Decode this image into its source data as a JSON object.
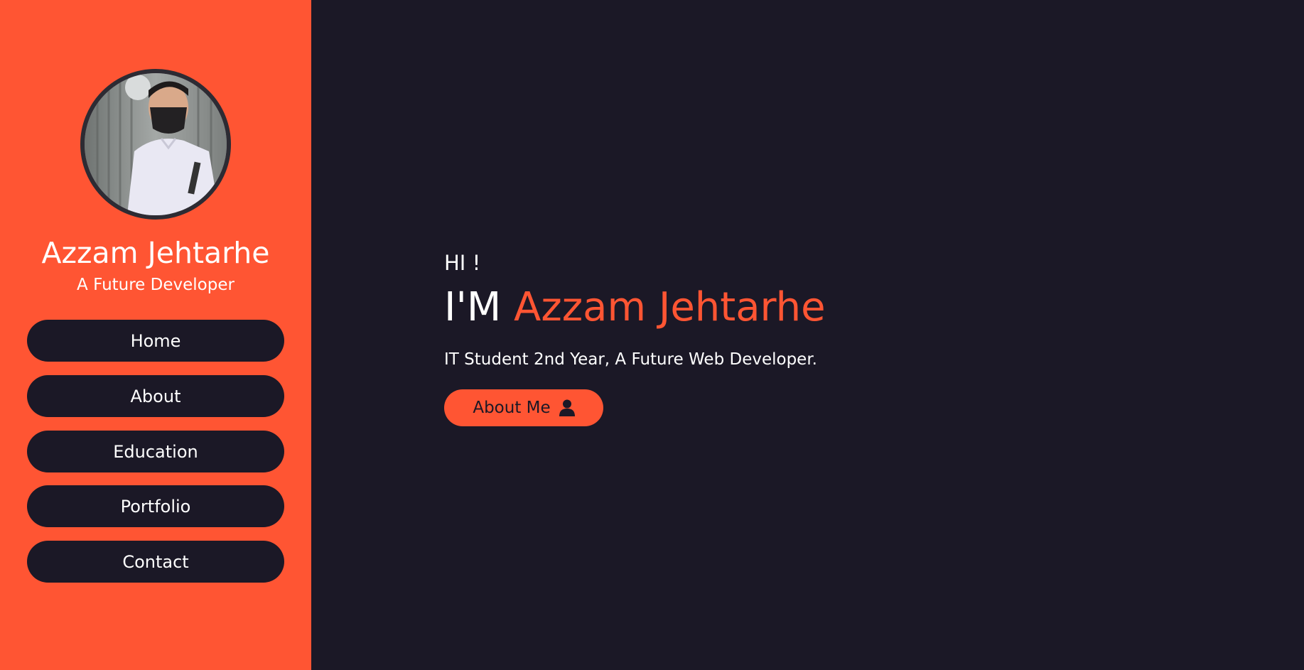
{
  "colors": {
    "accent": "#ff5533",
    "background": "#1b1826",
    "text": "#ffffff"
  },
  "sidebar": {
    "avatar_icon": "avatar",
    "name": "Azzam Jehtarhe",
    "role": "A Future Developer",
    "nav": [
      {
        "label": "Home"
      },
      {
        "label": "About"
      },
      {
        "label": "Education"
      },
      {
        "label": "Portfolio"
      },
      {
        "label": "Contact"
      }
    ]
  },
  "hero": {
    "greeting": "HI !",
    "title_prefix": "I'M",
    "title_name": "Azzam Jehtarhe",
    "subtitle": "IT Student 2nd Year, A Future Web Developer.",
    "button_label": "About Me",
    "button_icon": "user-icon"
  }
}
